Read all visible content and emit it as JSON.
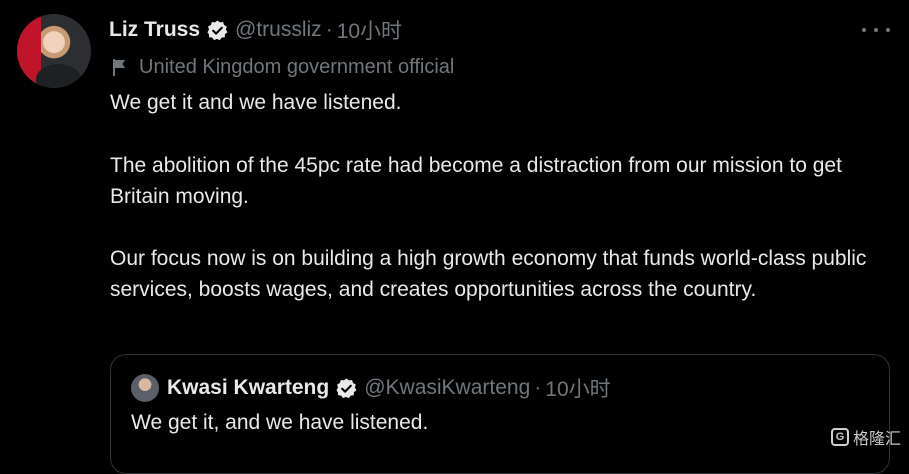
{
  "tweet": {
    "author_name": "Liz Truss",
    "handle": "@trussliz",
    "separator": "·",
    "time": "10小时",
    "label": "United Kingdom government official",
    "paragraphs": [
      "We get it and we have listened.",
      "The abolition of the 45pc rate had become a distraction from our mission to get Britain moving.",
      "Our focus now is on building a high growth economy that funds world-class public services, boosts wages, and creates opportunities across the country."
    ]
  },
  "quoted_tweet": {
    "author_name": "Kwasi Kwarteng",
    "handle": "@KwasiKwarteng",
    "separator": "·",
    "time": "10小时",
    "text": "We get it, and we have listened."
  },
  "watermark": {
    "logo_text": "G",
    "text": "格隆汇"
  },
  "icons": {
    "verified": "verified-badge-icon",
    "flag": "flag-icon",
    "more": "more-options-icon"
  },
  "colors": {
    "background": "#000000",
    "text_primary": "#e7e9ea",
    "text_secondary": "#71767b",
    "border": "#2f3336"
  }
}
